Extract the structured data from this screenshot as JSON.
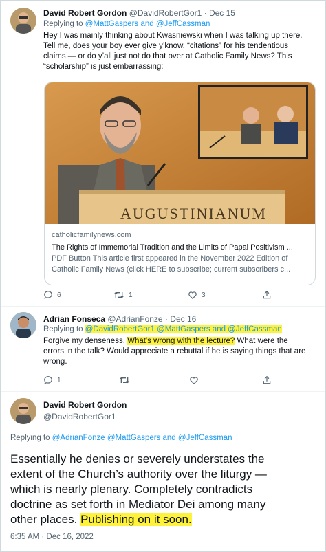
{
  "tweet1": {
    "name": "David Robert Gordon",
    "handle": "@DavidRobertGor1",
    "date": "Dec 15",
    "reply_prefix": "Replying to",
    "reply_mentions": "@MattGaspers and @JeffCassman",
    "lines": [
      "Hey I was mainly thinking about Kwasniewski when I was talking up there.",
      "Tell me, does your boy ever give y’know, “citations” for his tendentious",
      "claims — or do y’all just not do that over at Catholic Family News? This",
      "“scholarship” is just embarrassing:"
    ],
    "card": {
      "image_text": "AUGUSTINIANUM",
      "domain": "catholicfamilynews.com",
      "title": "The Rights of Immemorial Tradition and the Limits of Papal Positivism ...",
      "desc1": "PDF Button This article first appeared in the November 2022 Edition of",
      "desc2": "Catholic Family News (click HERE to subscribe; current subscribers c..."
    },
    "actions": {
      "replies": "6",
      "retweets": "1",
      "likes": "3"
    }
  },
  "tweet2": {
    "name": "Adrian Fonseca",
    "handle": "@AdrianFonze",
    "date": "Dec 16",
    "reply_prefix": "Replying to",
    "reply_mentions": "@DavidRobertGor1 @MattGaspers and @JeffCassman",
    "line1_pre": "Forgive my denseness. ",
    "line1_hl": "What's wrong with the lecture?",
    "line1_post": " What were the",
    "line2": "errors in the talk? Would appreciate a rebuttal if he is saying things that are",
    "line3": "wrong.",
    "actions": {
      "replies": "1"
    }
  },
  "tweet3": {
    "name": "David Robert Gordon",
    "handle": "@DavidRobertGor1",
    "reply_prefix": "Replying to",
    "reply_mentions": "@AdrianFonze @MattGaspers and @JeffCassman",
    "lines": [
      "Essentially he denies or severely understates the",
      "extent of the Church’s authority over the liturgy —",
      "which is nearly plenary. Completely contradicts",
      "doctrine as set forth in Mediator Dei among many"
    ],
    "line5_pre": "other places. ",
    "line5_hl": "Publishing on it soon.",
    "timestamp": "6:35 AM · Dec 16, 2022"
  },
  "colors": {
    "link": "#1d9bf0",
    "highlight": "#fff23a",
    "muted": "#536471"
  }
}
